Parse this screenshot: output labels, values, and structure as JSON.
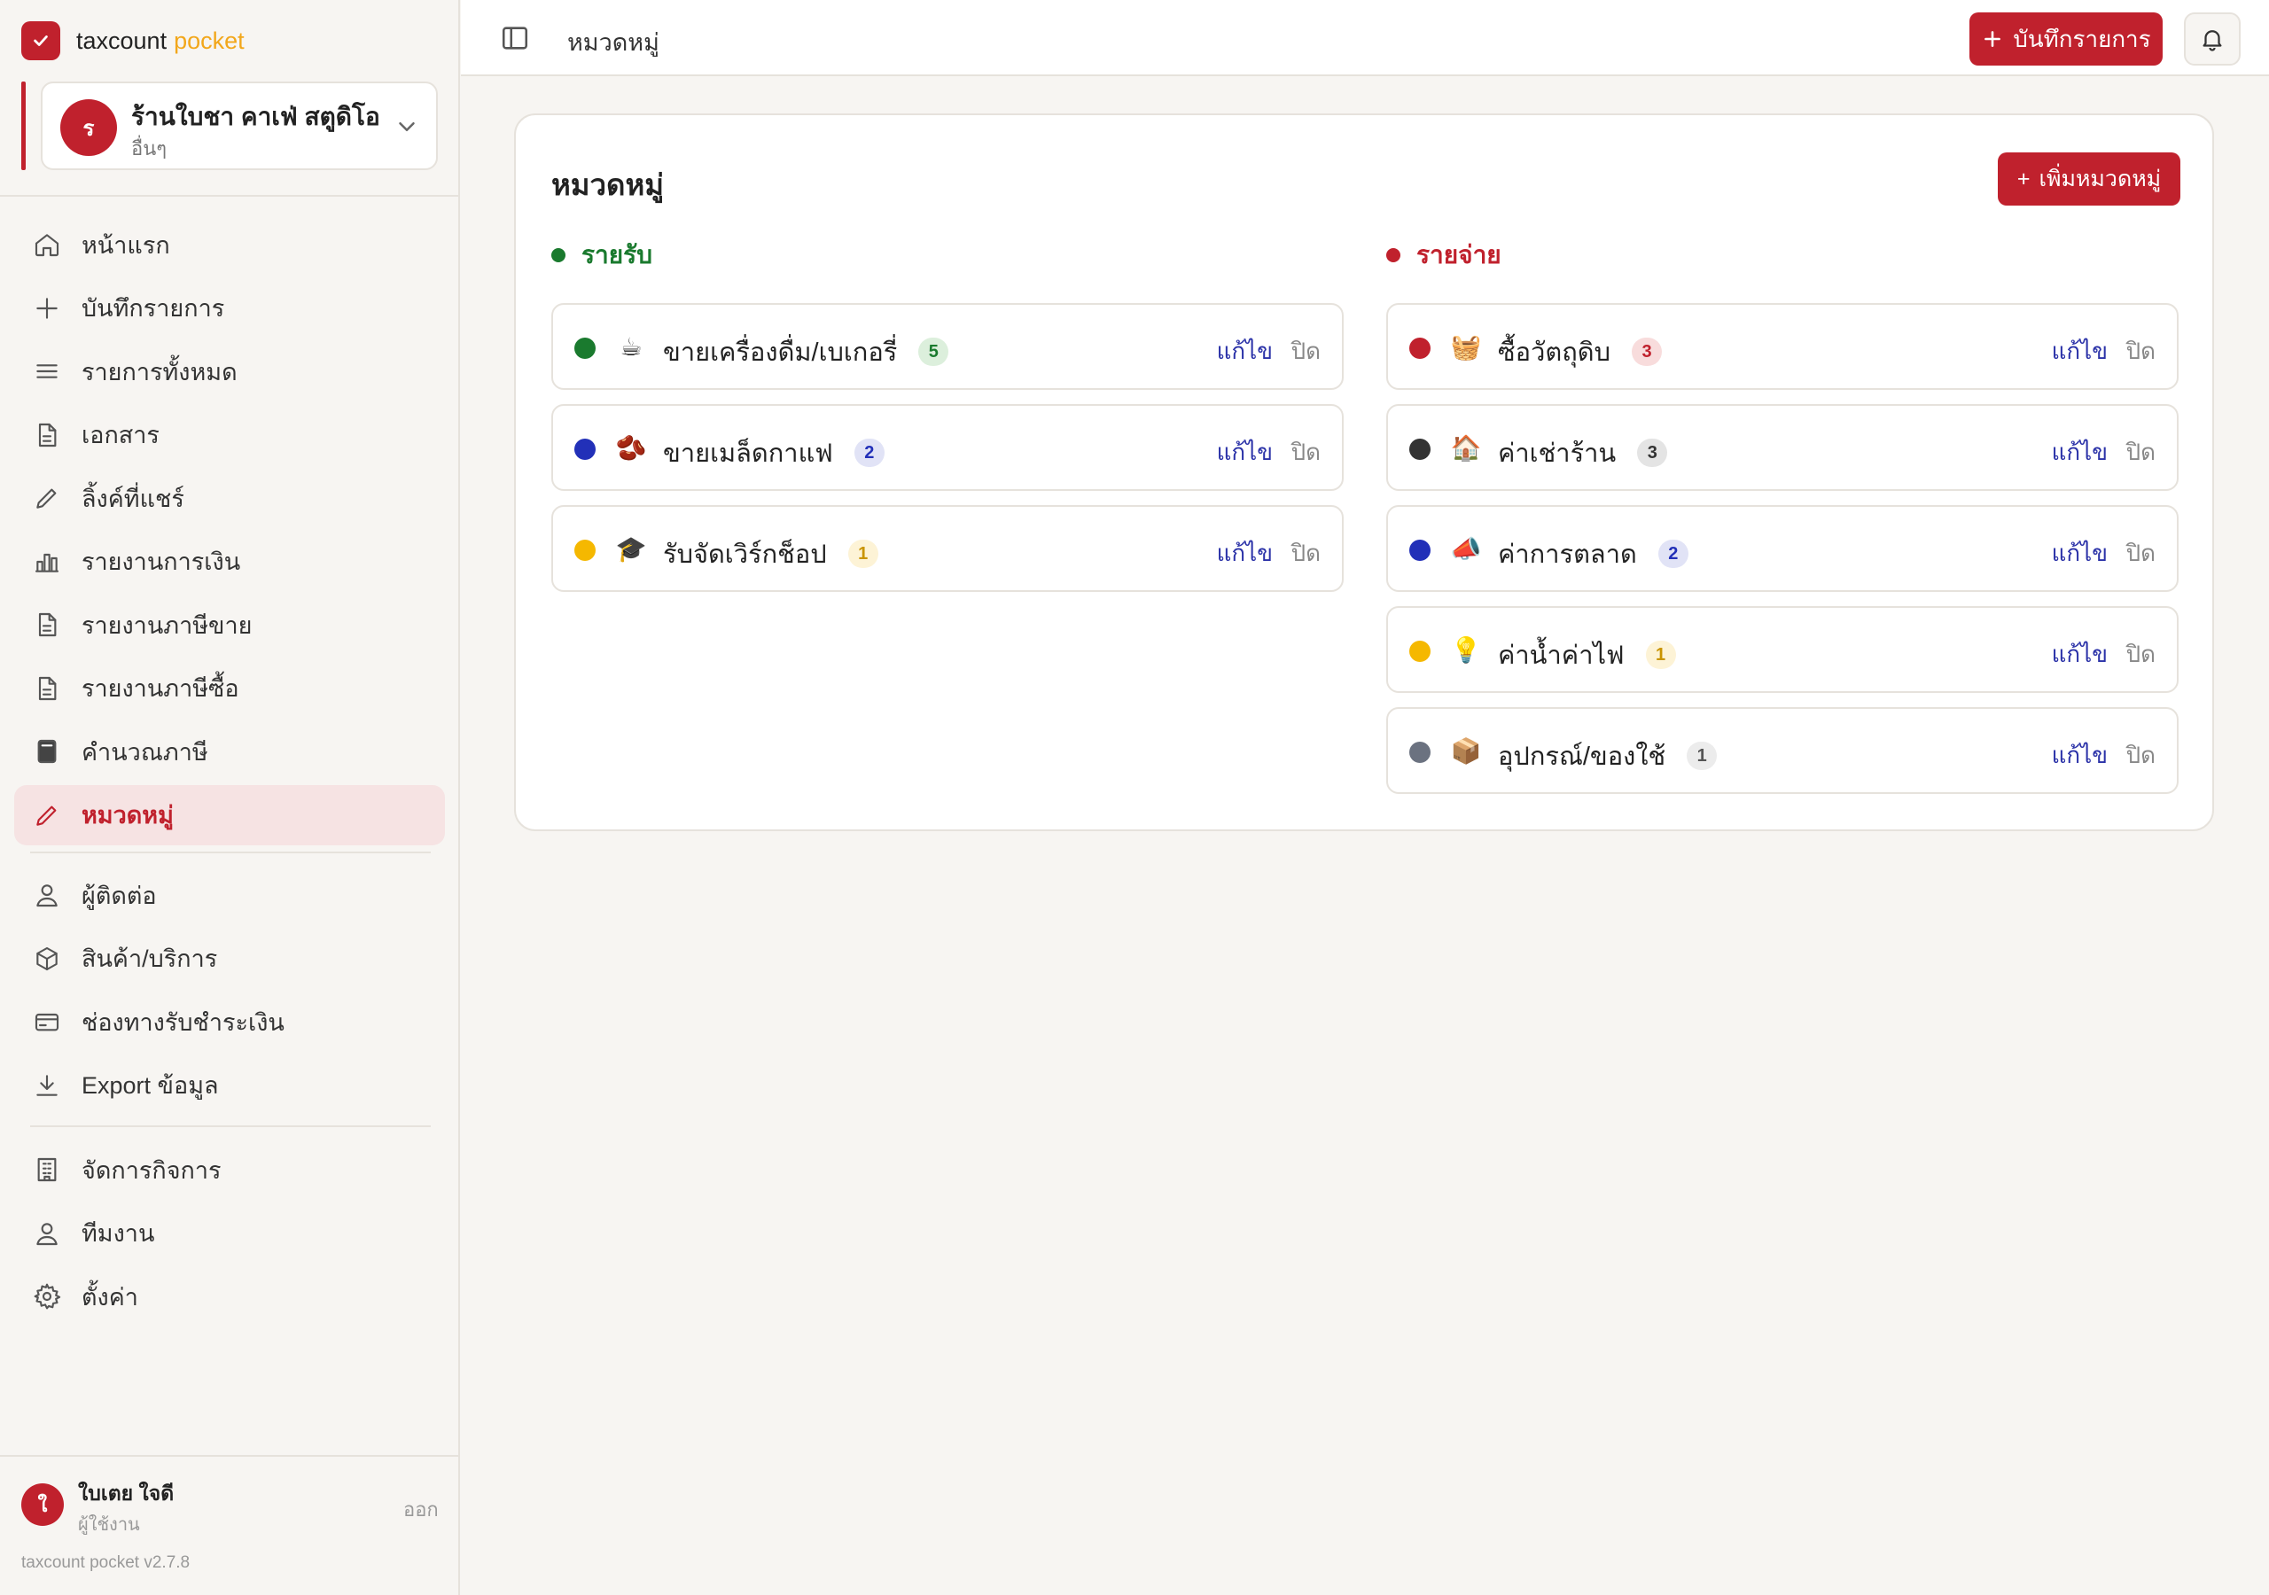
{
  "brand": {
    "name": "taxcount",
    "accent": "pocket"
  },
  "business": {
    "initial": "ร",
    "name": "ร้านใบชา คาเฟ่ สตูดิโอ",
    "type": "อื่นๆ"
  },
  "nav": {
    "main": [
      {
        "id": "home",
        "label": "หน้าแรก",
        "icon": "home-icon"
      },
      {
        "id": "record",
        "label": "บันทึกรายการ",
        "icon": "plus-icon"
      },
      {
        "id": "all",
        "label": "รายการทั้งหมด",
        "icon": "list-icon"
      },
      {
        "id": "docs",
        "label": "เอกสาร",
        "icon": "document-icon"
      },
      {
        "id": "share",
        "label": "ลิ้งค์ที่แชร์",
        "icon": "pencil-icon"
      },
      {
        "id": "finance",
        "label": "รายงานการเงิน",
        "icon": "bar-chart-icon"
      },
      {
        "id": "sales-tax",
        "label": "รายงานภาษีขาย",
        "icon": "document-icon"
      },
      {
        "id": "purchase-tax",
        "label": "รายงานภาษีซื้อ",
        "icon": "document-icon"
      },
      {
        "id": "calc",
        "label": "คำนวณภาษี",
        "icon": "calculator-icon"
      },
      {
        "id": "categories",
        "label": "หมวดหมู่",
        "icon": "pencil-icon",
        "active": true
      }
    ],
    "secondary": [
      {
        "id": "contacts",
        "label": "ผู้ติดต่อ",
        "icon": "user-icon"
      },
      {
        "id": "products",
        "label": "สินค้า/บริการ",
        "icon": "box-icon"
      },
      {
        "id": "payments",
        "label": "ช่องทางรับชำระเงิน",
        "icon": "credit-card-icon"
      },
      {
        "id": "export",
        "label": "Export ข้อมูล",
        "icon": "download-icon"
      }
    ],
    "tertiary": [
      {
        "id": "business",
        "label": "จัดการกิจการ",
        "icon": "building-icon"
      },
      {
        "id": "team",
        "label": "ทีมงาน",
        "icon": "user-icon"
      },
      {
        "id": "settings",
        "label": "ตั้งค่า",
        "icon": "gear-icon"
      }
    ]
  },
  "user": {
    "initial": "ใ",
    "name": "ใบเตย ใจดี",
    "role": "ผู้ใช้งาน",
    "logout": "ออก"
  },
  "version": "taxcount pocket v2.7.8",
  "topbar": {
    "breadcrumb": "หมวดหมู่",
    "record_button": "บันทึกรายการ"
  },
  "page": {
    "title": "หมวดหมู่",
    "add_button": "เพิ่มหมวดหมู่"
  },
  "income": {
    "heading": "รายรับ",
    "color": "#1a7a2e",
    "categories": [
      {
        "emoji": "☕",
        "name": "ขายเครื่องดื่ม/เบเกอรี่",
        "count": "5",
        "color": "#1a7a2e",
        "badge_bg": "#dcefdc",
        "badge_fg": "#1a7a2e"
      },
      {
        "emoji": "🫘",
        "name": "ขายเมล็ดกาแฟ",
        "count": "2",
        "color": "#2230b8",
        "badge_bg": "#e1e3f6",
        "badge_fg": "#2230b8"
      },
      {
        "emoji": "🎓",
        "name": "รับจัดเวิร์กช็อป",
        "count": "1",
        "color": "#f5b800",
        "badge_bg": "#fdf3d6",
        "badge_fg": "#c99400"
      }
    ]
  },
  "expense": {
    "heading": "รายจ่าย",
    "color": "#c0212d",
    "categories": [
      {
        "emoji": "🧺",
        "name": "ซื้อวัตถุดิบ",
        "count": "3",
        "color": "#c0212d",
        "badge_bg": "#f8dcdc",
        "badge_fg": "#c0212d"
      },
      {
        "emoji": "🏠",
        "name": "ค่าเช่าร้าน",
        "count": "3",
        "color": "#333333",
        "badge_bg": "#e4e4e4",
        "badge_fg": "#333333"
      },
      {
        "emoji": "📣",
        "name": "ค่าการตลาด",
        "count": "2",
        "color": "#2230b8",
        "badge_bg": "#e1e3f6",
        "badge_fg": "#2230b8"
      },
      {
        "emoji": "💡",
        "name": "ค่าน้ำค่าไฟ",
        "count": "1",
        "color": "#f5b800",
        "badge_bg": "#fdf3d6",
        "badge_fg": "#c99400"
      },
      {
        "emoji": "📦",
        "name": "อุปกรณ์/ของใช้",
        "count": "1",
        "color": "#6b7280",
        "badge_bg": "#ececec",
        "badge_fg": "#555555"
      }
    ]
  },
  "actions": {
    "edit": "แก้ไข",
    "close": "ปิด"
  }
}
